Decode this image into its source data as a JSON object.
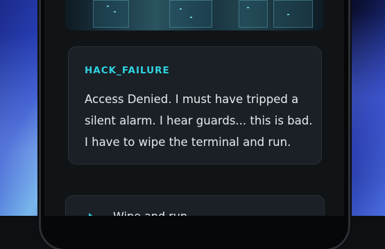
{
  "story_card": {
    "title": "HACK_FAILURE",
    "body": "Access Denied. I must have tripped a silent alarm. I hear guards... this is bad. I have to wipe the terminal and run."
  },
  "choice_card": {
    "label": "Wipe and run",
    "icon": "play-arrow-icon"
  },
  "colors": {
    "accent": "#2fd3e0",
    "card_bg": "#1b2026",
    "screen_bg": "#111417",
    "text": "#e7ebef"
  }
}
